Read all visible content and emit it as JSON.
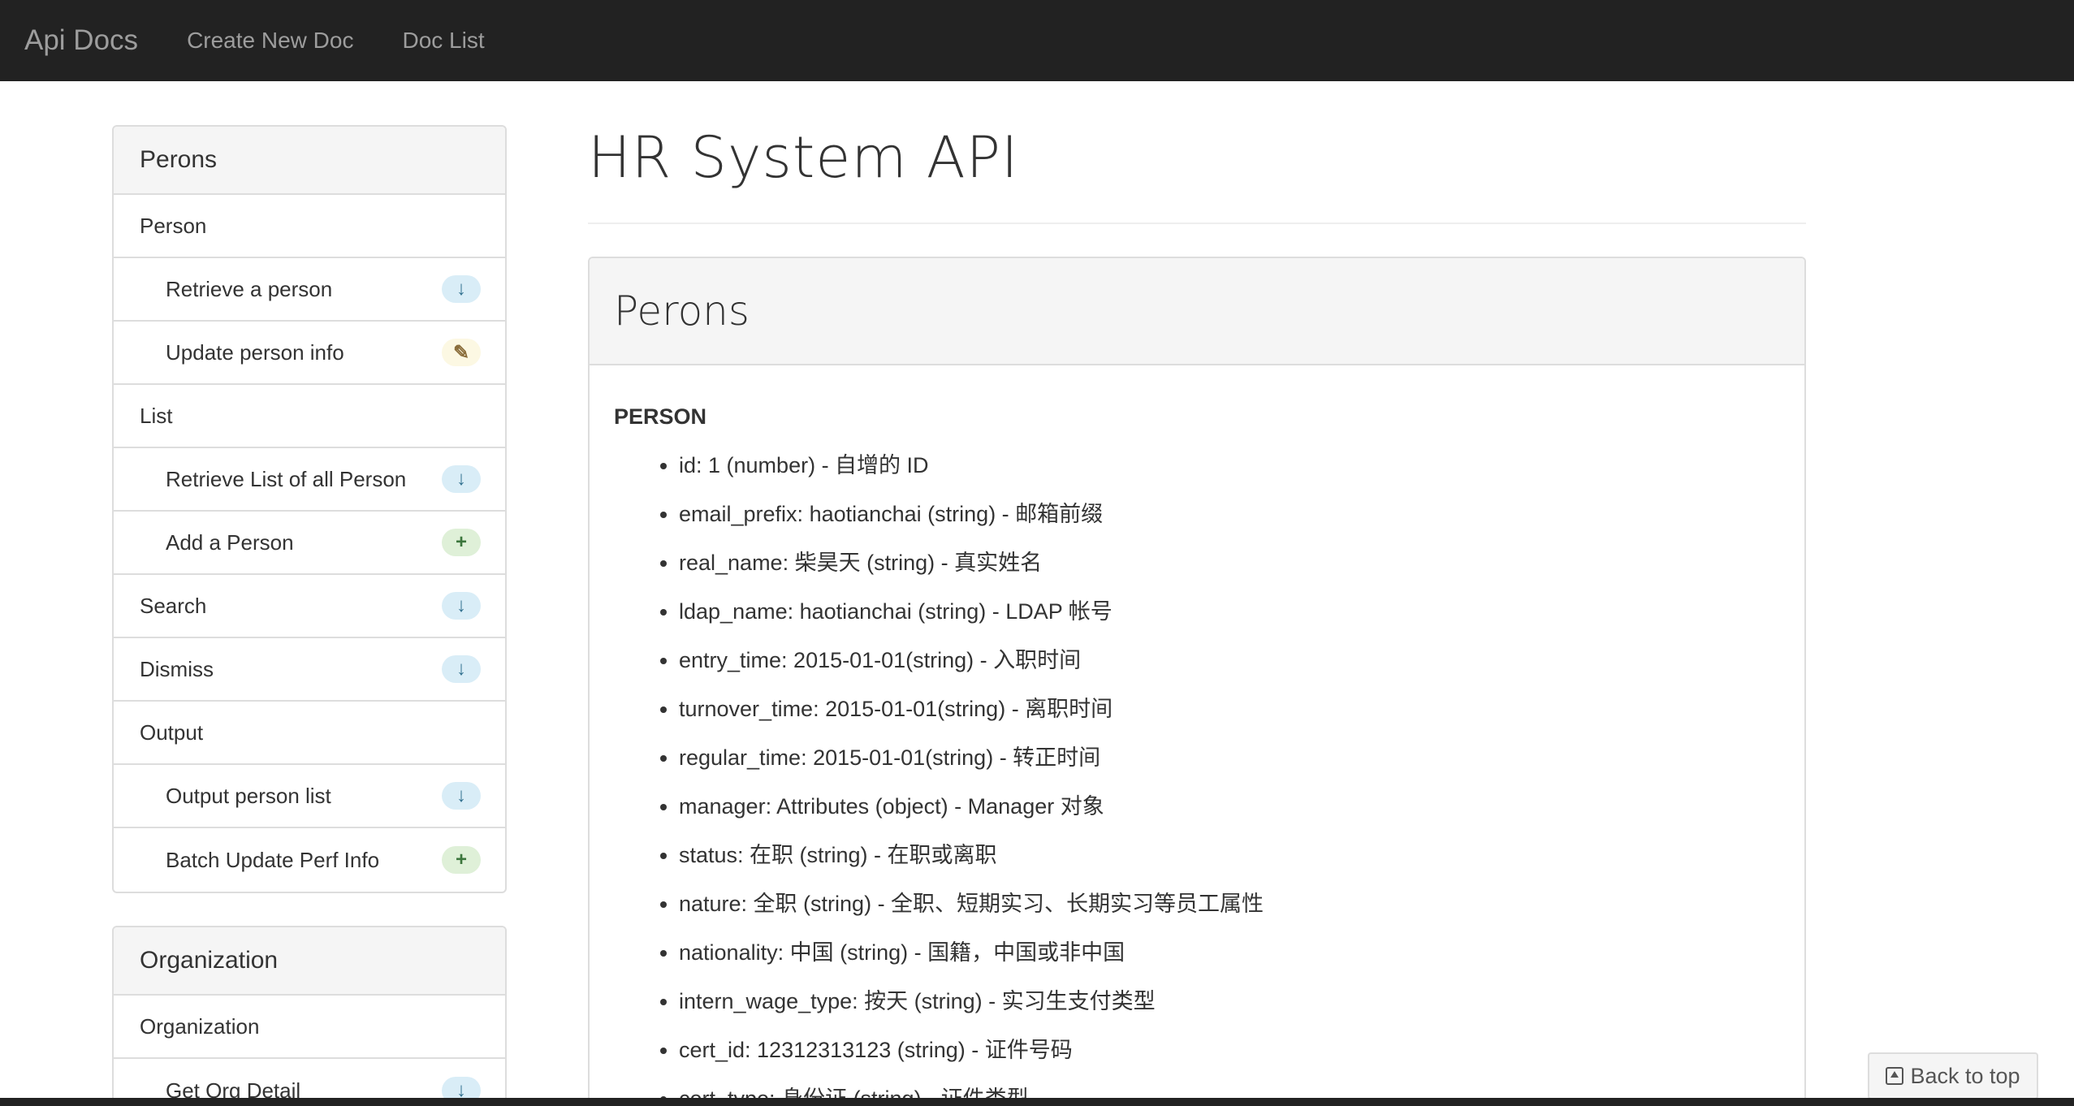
{
  "navbar": {
    "brand": "Api Docs",
    "links": [
      "Create New Doc",
      "Doc List"
    ]
  },
  "sidebar": {
    "panels": [
      {
        "title": "Perons",
        "items": [
          {
            "label": "Person",
            "type": "group"
          },
          {
            "label": "Retrieve a person",
            "type": "sub",
            "method": "get",
            "icon": "arrow-down-icon",
            "glyph": "↓"
          },
          {
            "label": "Update person info",
            "type": "sub",
            "method": "put",
            "icon": "pencil-icon",
            "glyph": "✎"
          },
          {
            "label": "List",
            "type": "group"
          },
          {
            "label": "Retrieve List of all Person",
            "type": "sub",
            "method": "get",
            "icon": "arrow-down-icon",
            "glyph": "↓"
          },
          {
            "label": "Add a Person",
            "type": "sub",
            "method": "post",
            "icon": "plus-icon",
            "glyph": "+"
          },
          {
            "label": "Search",
            "type": "group",
            "method": "get",
            "icon": "arrow-down-icon",
            "glyph": "↓"
          },
          {
            "label": "Dismiss",
            "type": "group",
            "method": "get",
            "icon": "arrow-down-icon",
            "glyph": "↓"
          },
          {
            "label": "Output",
            "type": "group"
          },
          {
            "label": "Output person list",
            "type": "sub",
            "method": "get",
            "icon": "arrow-down-icon",
            "glyph": "↓"
          },
          {
            "label": "Batch Update Perf Info",
            "type": "sub",
            "method": "post",
            "icon": "plus-icon",
            "glyph": "+"
          }
        ]
      },
      {
        "title": "Organization",
        "items": [
          {
            "label": "Organization",
            "type": "group"
          },
          {
            "label": "Get Org Detail",
            "type": "sub",
            "method": "get",
            "icon": "arrow-down-icon",
            "glyph": "↓"
          }
        ]
      }
    ]
  },
  "main": {
    "title": "HR System API",
    "panel_title": "Perons",
    "section_title": "PERSON",
    "attributes": [
      "id: 1 (number) - 自增的 ID",
      "email_prefix: haotianchai (string) - 邮箱前缀",
      "real_name: 柴昊天 (string) - 真实姓名",
      "ldap_name: haotianchai (string) - LDAP 帐号",
      "entry_time: 2015-01-01(string) - 入职时间",
      "turnover_time: 2015-01-01(string) - 离职时间",
      "regular_time: 2015-01-01(string) - 转正时间",
      "manager: Attributes (object) - Manager 对象",
      "status: 在职 (string) - 在职或离职",
      "nature: 全职 (string) - 全职、短期实习、长期实习等员工属性",
      "nationality: 中国 (string) - 国籍，中国或非中国",
      "intern_wage_type: 按天 (string) - 实习生支付类型",
      "cert_id: 12312313123 (string) - 证件号码",
      "cert_type: 身份证 (string) - 证件类型"
    ]
  },
  "back_to_top": "Back to top",
  "colors": {
    "navbar_bg": "#222222",
    "get_badge": "#d9edf7",
    "put_badge": "#fcf8e3",
    "post_badge": "#dff0d8"
  }
}
